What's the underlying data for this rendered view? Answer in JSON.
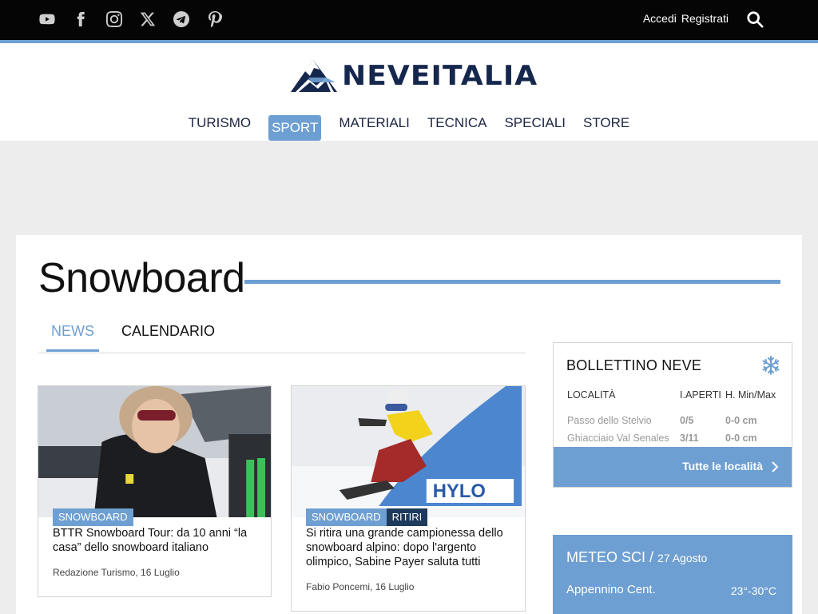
{
  "colors": {
    "accent": "#6e9fd2",
    "dark_tag": "#1e3a5c",
    "topbar": "#050505",
    "logo_navy": "#16274d"
  },
  "social_icons": [
    "youtube-icon",
    "facebook-icon",
    "instagram-icon",
    "x-icon",
    "telegram-icon",
    "pinterest-icon"
  ],
  "top_links": {
    "login": "Accedi",
    "register": "Registrati"
  },
  "logo": {
    "text": "NEVEITALIA"
  },
  "nav": {
    "items": [
      {
        "label": "TURISMO",
        "active": false
      },
      {
        "label": "SPORT",
        "active": true
      },
      {
        "label": "MATERIALI",
        "active": false
      },
      {
        "label": "TECNICA",
        "active": false
      },
      {
        "label": "SPECIALI",
        "active": false
      },
      {
        "label": "STORE",
        "active": false
      }
    ]
  },
  "page": {
    "title": "Snowboard"
  },
  "tabs": {
    "news": "NEWS",
    "calendar": "CALENDARIO"
  },
  "articles": [
    {
      "tags": [
        "SNOWBOARD"
      ],
      "title": "BTTR Snowboard Tour: da 10 anni “la casa” dello snowboard italiano",
      "meta": "Redazione Turismo, 16 Luglio"
    },
    {
      "tags": [
        "SNOWBOARD",
        "RITIRI"
      ],
      "title": "Si ritira una grande campionessa dello snowboard alpino: dopo l'argento olimpico, Sabine Payer saluta tutti",
      "meta": "Fabio Poncemi, 16 Luglio",
      "image_text": "HYLO"
    }
  ],
  "bollettino": {
    "title": "BOLLETTINO NEVE",
    "headers": {
      "location": "LOCALITÀ",
      "lifts": "I.APERTI",
      "height": "H. Min/Max"
    },
    "rows": [
      {
        "location": "Passo dello Stelvio",
        "lifts": "0/5",
        "height": "0-0 cm"
      },
      {
        "location": "Ghiacciaio Val Senales",
        "lifts": "3/11",
        "height": "0-0 cm"
      }
    ],
    "button": "Tutte le località"
  },
  "meteo": {
    "title": "METEO SCI /",
    "date": "27 Agosto",
    "location": "Appennino Cent.",
    "temp": "23°-30°C"
  }
}
